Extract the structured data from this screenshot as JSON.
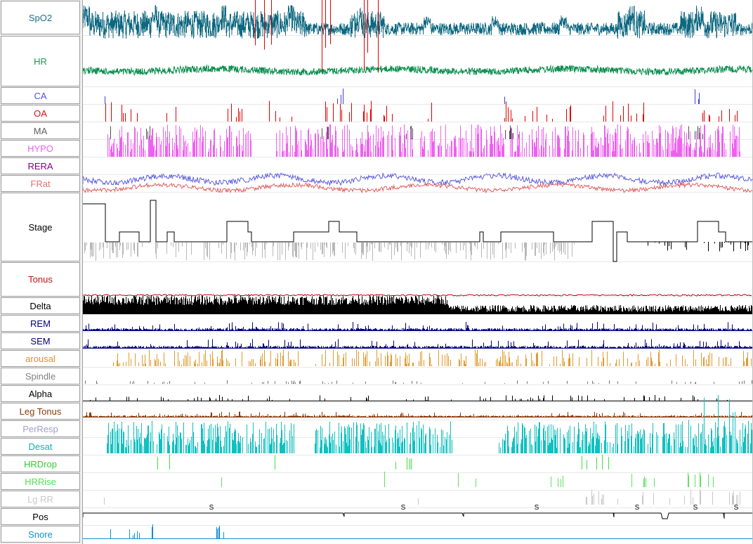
{
  "channels": [
    {
      "label": "SpO2",
      "color": "#1b6f86"
    },
    {
      "label": "HR",
      "color": "#1a9a4a"
    },
    {
      "label": "CA",
      "color": "#5050e0"
    },
    {
      "label": "OA",
      "color": "#e01010"
    },
    {
      "label": "MA",
      "color": "#606060"
    },
    {
      "label": "HYPO",
      "color": "#f060f0"
    },
    {
      "label": "RERA",
      "color": "#800080"
    },
    {
      "label": "FRat",
      "color": "#e07070"
    },
    {
      "label": "Stage",
      "color": "#000000"
    },
    {
      "label": "Tonus",
      "color": "#c01010"
    },
    {
      "label": "Delta",
      "color": "#000000"
    },
    {
      "label": "REM",
      "color": "#000080"
    },
    {
      "label": "SEM",
      "color": "#000080"
    },
    {
      "label": "arousal",
      "color": "#e09030"
    },
    {
      "label": "Spindle",
      "color": "#808080"
    },
    {
      "label": "Alpha",
      "color": "#000000"
    },
    {
      "label": "Leg Tonus",
      "color": "#8b3a0a"
    },
    {
      "label": "PerResp",
      "color": "#a0a0c8"
    },
    {
      "label": "Desat",
      "color": "#10b0b0"
    },
    {
      "label": "HRDrop",
      "color": "#30d030"
    },
    {
      "label": "HRRise",
      "color": "#50e050"
    },
    {
      "label": "Lg RR",
      "color": "#c8c8c8"
    },
    {
      "label": "Pos",
      "color": "#000000"
    },
    {
      "label": "Snore",
      "color": "#1090d0"
    }
  ],
  "position_markers": [
    "S",
    "S",
    "S",
    "S",
    "S",
    "S"
  ],
  "colors": {
    "spo2": "#0e6880",
    "hr": "#0d9050",
    "ca": "#4040d8",
    "oa": "#e00000",
    "ma": "#505050",
    "hypo": "#f060f0",
    "frat_blue": "#6060e0",
    "frat_red": "#e06060",
    "stage": "#000000",
    "stage_gray": "#b8b8b8",
    "tonus": "#c00000",
    "delta": "#000000",
    "rem": "#000080",
    "arousal": "#e09a30",
    "spindle": "#707070",
    "leg": "#8b3a0a",
    "desat": "#10c0c0",
    "hrdrop": "#40e040",
    "hrrise": "#60e060",
    "lgrr": "#c8c8c8",
    "snore": "#1090d0",
    "pos": "#000000"
  }
}
